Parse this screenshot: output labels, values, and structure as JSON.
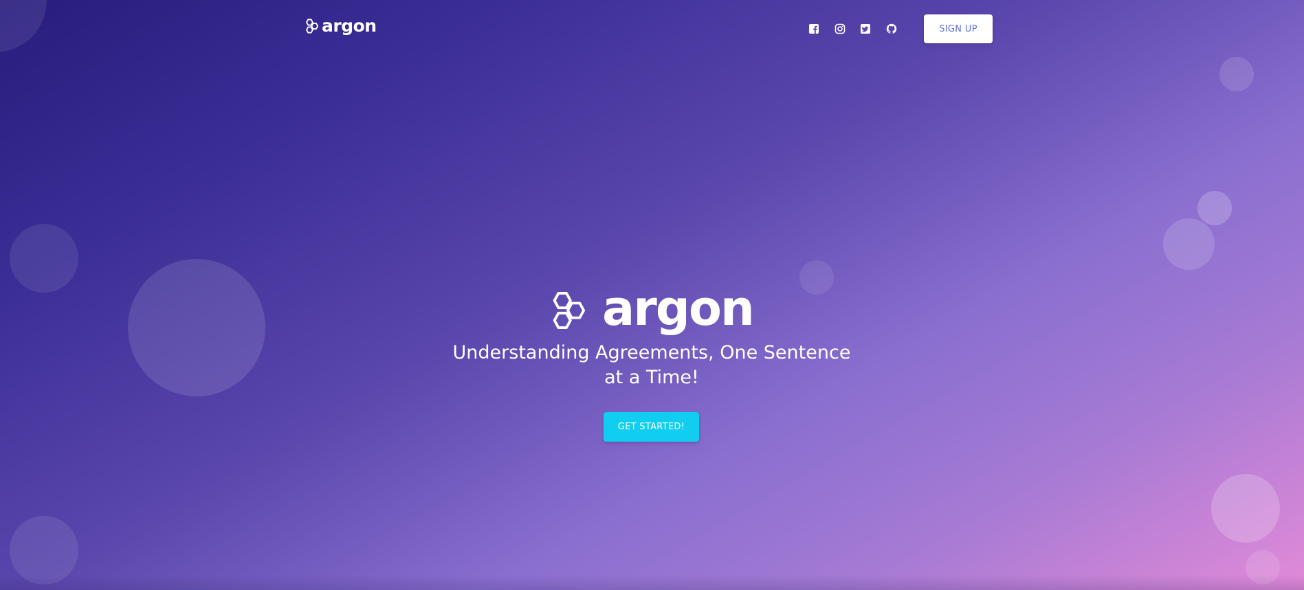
{
  "navbar": {
    "brand_text": "argon",
    "brand_icon": "hexagon-logo-icon",
    "social_links": [
      {
        "name": "facebook",
        "icon": "facebook-icon"
      },
      {
        "name": "instagram",
        "icon": "instagram-icon"
      },
      {
        "name": "twitter",
        "icon": "twitter-icon"
      },
      {
        "name": "github",
        "icon": "github-icon"
      }
    ],
    "signup_label": "SIGN UP"
  },
  "hero": {
    "logo_text": "argon",
    "logo_icon": "hexagon-logo-icon",
    "tagline": "Understanding Agreements, One Sentence at a Time!",
    "cta_label": "GET STARTED!"
  },
  "colors": {
    "primary": "#5e72e4",
    "info": "#11cdef",
    "gradient_start": "#281c7d",
    "gradient_end": "#e28ad8",
    "text_light": "#ffffff"
  }
}
